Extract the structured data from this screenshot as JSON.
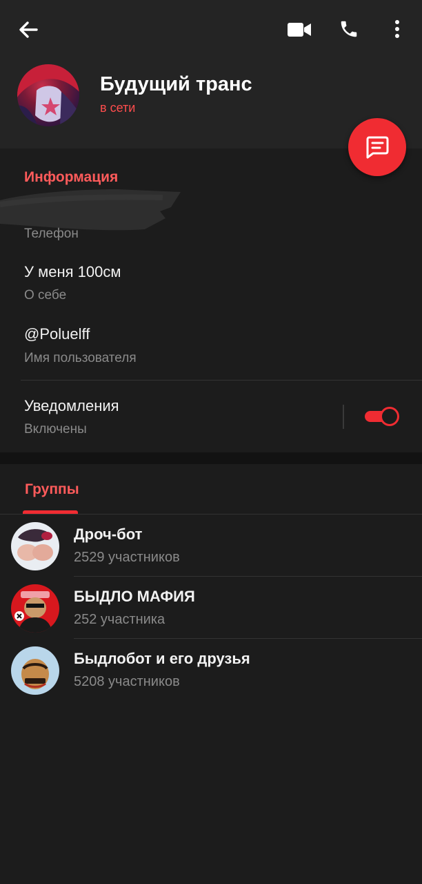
{
  "header": {
    "title": "Будущий транс",
    "status": "в сети"
  },
  "icons": {
    "back": "arrow-left-icon",
    "video": "video-camera-icon",
    "call": "phone-icon",
    "more": "more-vert-icon",
    "message": "chat-bubble-icon"
  },
  "info": {
    "section_title": "Информация",
    "phone_label": "Телефон",
    "bio_value": "У меня 100см",
    "bio_label": "О себе",
    "username_value": "@Poluelff",
    "username_label": "Имя пользователя",
    "notifications_title": "Уведомления",
    "notifications_value": "Включены",
    "notifications_enabled": true
  },
  "tabs": {
    "groups_label": "Группы"
  },
  "groups": [
    {
      "name": "Дроч-бот",
      "members": "2529 участников"
    },
    {
      "name": "БЫДЛО МАФИЯ",
      "members": "252 участника"
    },
    {
      "name": "Быдлобот и его друзья",
      "members": "5208 участников"
    }
  ],
  "colors": {
    "accent": "#f02c32",
    "accent_text": "#ff5b5b",
    "background": "#1c1c1c",
    "header": "#242424",
    "secondary_text": "#8a8a8a"
  }
}
